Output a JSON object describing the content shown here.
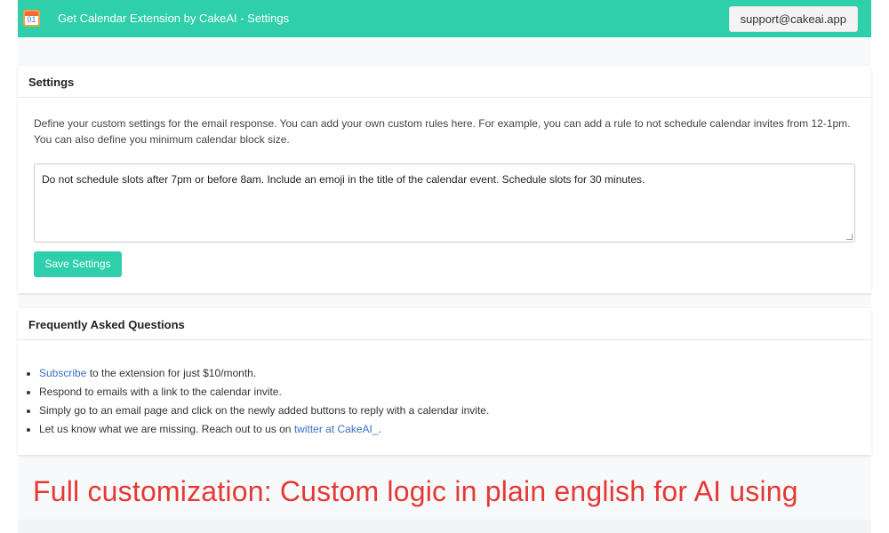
{
  "header": {
    "title": "Get Calendar Extension by CakeAI - Settings",
    "icon_text": "01",
    "support_label": "support@cakeai.app"
  },
  "settings": {
    "heading": "Settings",
    "description": "Define your custom settings for the email response. You can add your own custom rules here. For example, you can add a rule to not schedule calendar invites from 12-1pm. You can also define you minimum calendar block size.",
    "rules_value": "Do not schedule slots after 7pm or before 8am. Include an emoji in the title of the calendar event. Schedule slots for 30 minutes.",
    "save_label": "Save Settings"
  },
  "faq": {
    "heading": "Frequently Asked Questions",
    "item1_link": "Subscribe",
    "item1_rest": " to the extension for just $10/month.",
    "item2": "Respond to emails with a link to the calendar invite.",
    "item3": "Simply go to an email page and click on the newly added buttons to reply with a calendar invite.",
    "item4_pre": "Let us know what we are missing. Reach out to us on ",
    "item4_link": "twitter at CakeAI_",
    "item4_post": "."
  },
  "caption": "Full customization: Custom logic in plain english for AI using",
  "colors": {
    "accent": "#2ecfaa",
    "link": "#3b6fc2",
    "caption": "#e53935"
  }
}
